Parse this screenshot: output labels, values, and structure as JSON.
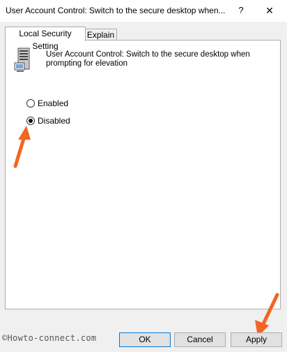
{
  "window": {
    "title": "User Account Control: Switch to the secure desktop when...",
    "help_glyph": "?",
    "close_glyph": "✕"
  },
  "tabs": [
    {
      "label": "Local Security Setting",
      "active": true
    },
    {
      "label": "Explain",
      "active": false
    }
  ],
  "policy": {
    "icon": "server-computer-icon",
    "description": "User Account Control: Switch to the secure desktop when prompting for elevation"
  },
  "options": [
    {
      "label": "Enabled",
      "checked": false
    },
    {
      "label": "Disabled",
      "checked": true
    }
  ],
  "watermark": "©Howto-connect.com",
  "buttons": {
    "ok": "OK",
    "cancel": "Cancel",
    "apply": "Apply"
  },
  "annotation_color": "#f26522"
}
